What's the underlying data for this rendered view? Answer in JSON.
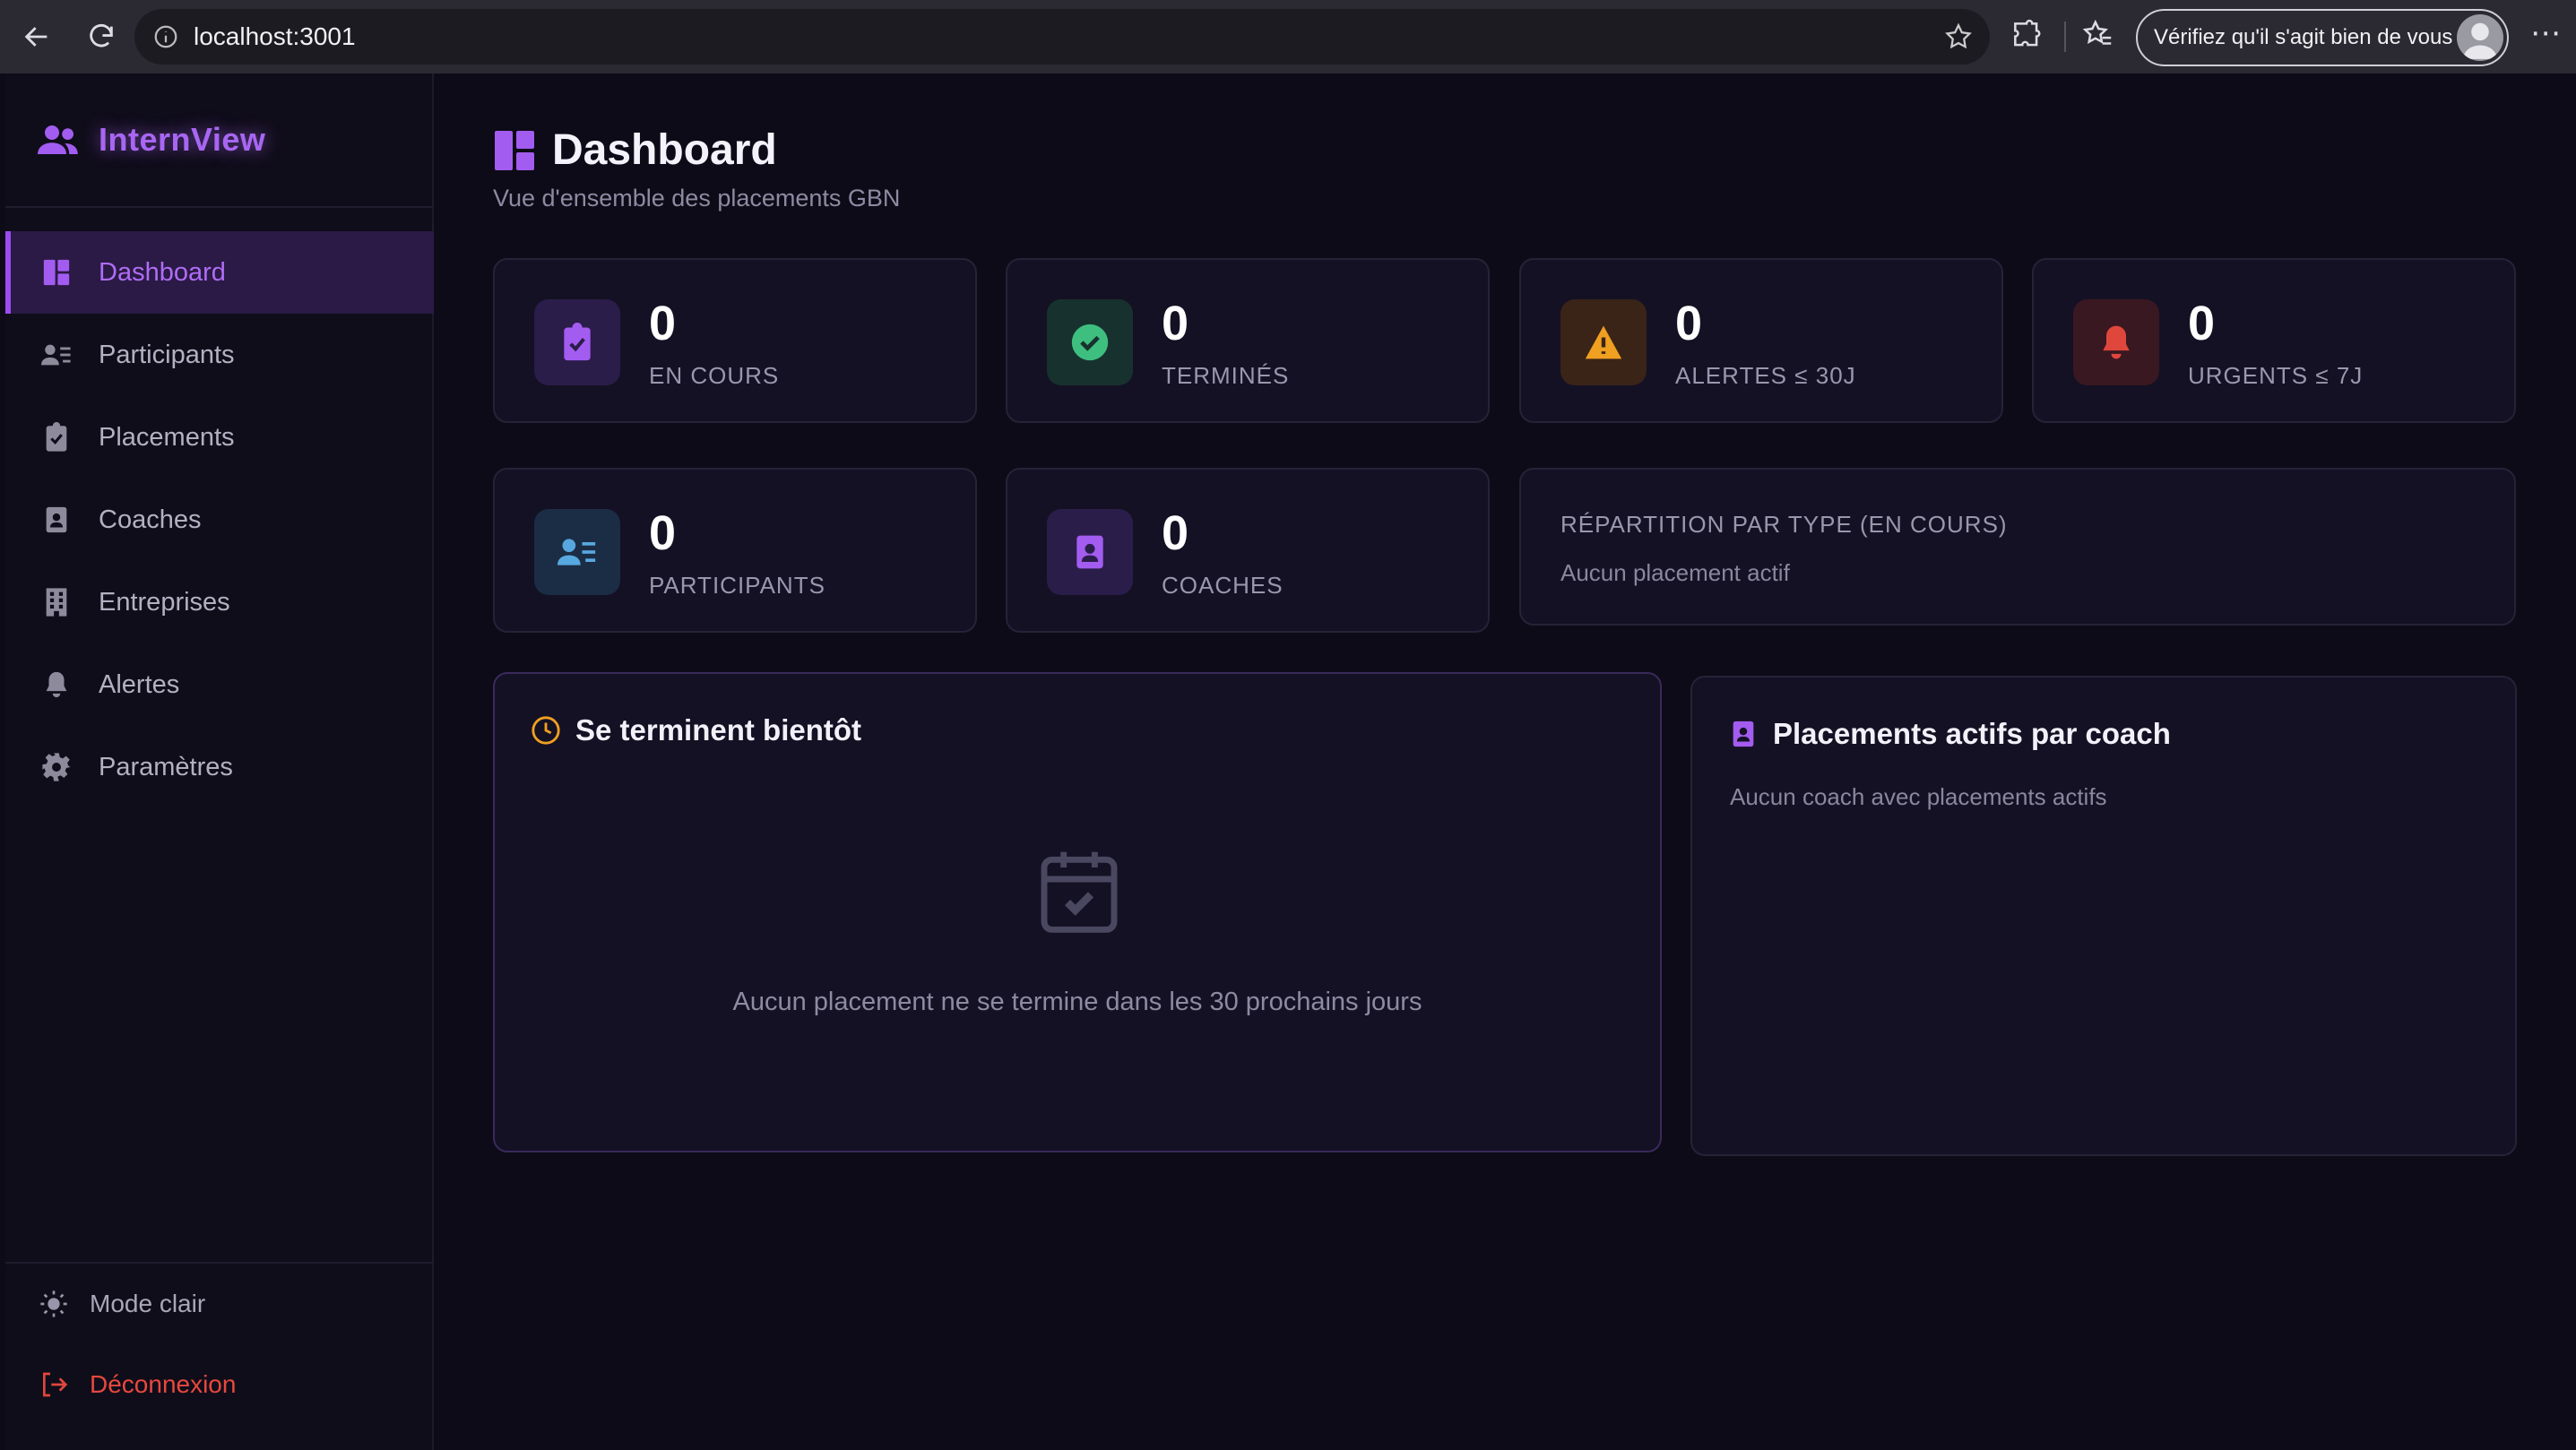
{
  "browser": {
    "url": "localhost:3001",
    "profile_button": "Vérifiez qu'il s'agit bien de vous",
    "more": "⋯"
  },
  "sidebar": {
    "brand": "InternView",
    "items": [
      {
        "label": "Dashboard",
        "icon": "dashboard-icon",
        "active": true
      },
      {
        "label": "Participants",
        "icon": "user-list-icon"
      },
      {
        "label": "Placements",
        "icon": "clipboard-check-icon"
      },
      {
        "label": "Coaches",
        "icon": "contact-badge-icon"
      },
      {
        "label": "Entreprises",
        "icon": "building-icon"
      },
      {
        "label": "Alertes",
        "icon": "bell-icon"
      },
      {
        "label": "Paramètres",
        "icon": "gear-icon"
      }
    ],
    "theme_toggle": "Mode clair",
    "logout": "Déconnexion"
  },
  "header": {
    "title": "Dashboard",
    "subtitle": "Vue d'ensemble des placements GBN"
  },
  "stats": {
    "en_cours": {
      "value": "0",
      "label": "EN COURS"
    },
    "termines": {
      "value": "0",
      "label": "TERMINÉS"
    },
    "alertes": {
      "value": "0",
      "label": "ALERTES ≤ 30J"
    },
    "urgents": {
      "value": "0",
      "label": "URGENTS ≤ 7J"
    },
    "participants": {
      "value": "0",
      "label": "PARTICIPANTS"
    },
    "coaches": {
      "value": "0",
      "label": "COACHES"
    }
  },
  "repartition": {
    "title": "RÉPARTITION PAR TYPE (EN COURS)",
    "empty": "Aucun placement actif"
  },
  "ending_soon": {
    "title": "Se terminent bientôt",
    "empty": "Aucun placement ne se termine dans les 30 prochains jours"
  },
  "by_coach": {
    "title": "Placements actifs par coach",
    "empty": "Aucun coach avec placements actifs"
  },
  "colors": {
    "accent": "#a35cf0",
    "success": "#3fbf7f",
    "warning": "#f0a020",
    "danger": "#e0473c",
    "info": "#58a8e0"
  }
}
